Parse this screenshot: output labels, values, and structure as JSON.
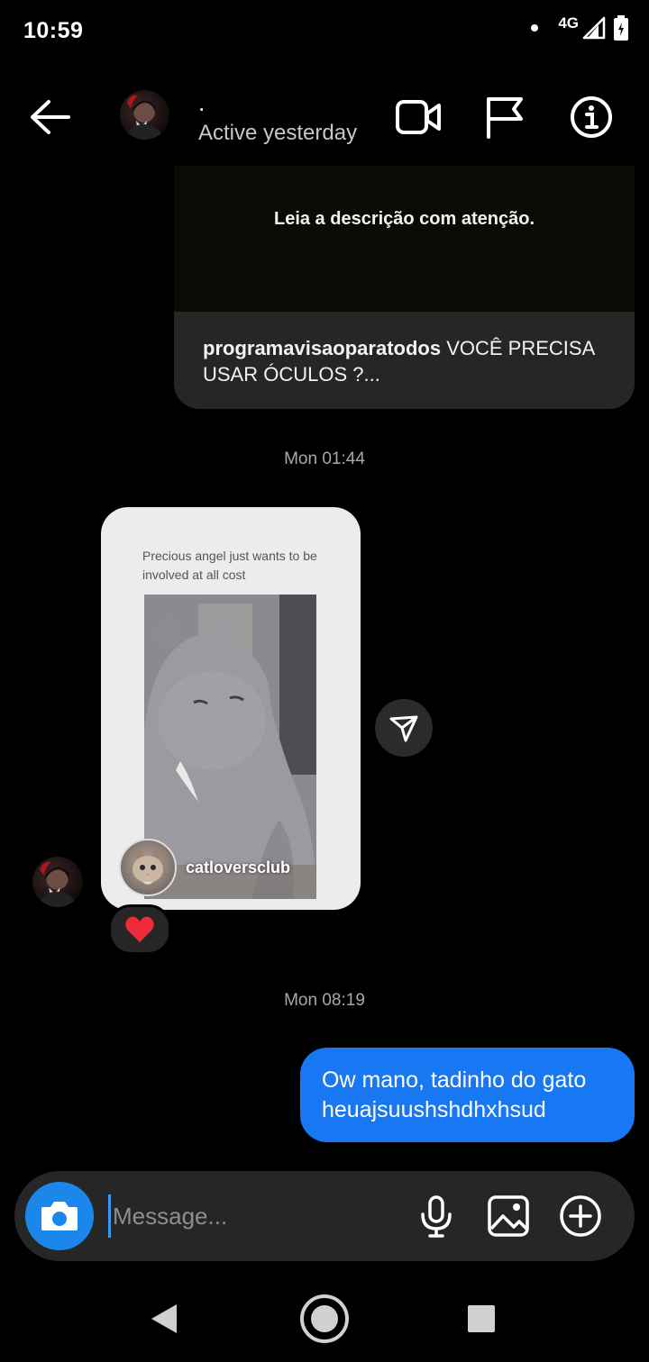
{
  "status_bar": {
    "time": "10:59",
    "network": "4G"
  },
  "header": {
    "name": ".",
    "status": "Active yesterday",
    "icons": [
      "back-arrow-icon",
      "video-call-icon",
      "flag-icon",
      "info-icon"
    ]
  },
  "shared_post": {
    "preview_text": "Leia a descrição com atenção.",
    "username": "programavisaoparatodos",
    "caption": "VOCÊ PRECISA USAR ÓCULOS ?..."
  },
  "timestamps": [
    "Mon 01:44",
    "Mon 08:19"
  ],
  "reel": {
    "caption": "Precious angel just wants to be involved at all cost",
    "username": "catloversclub"
  },
  "reaction": {
    "emoji": "heart"
  },
  "outgoing_message": "Ow mano, tadinho do gato heuajsuushshdhxhsud",
  "composer": {
    "placeholder": "Message...",
    "icons": [
      "camera-icon",
      "microphone-icon",
      "gallery-icon",
      "add-icon"
    ]
  },
  "nav_bar": {
    "icons": [
      "back-triangle-icon",
      "home-circle-icon",
      "recents-square-icon"
    ]
  },
  "colors": {
    "accent": "#1877f2",
    "camera": "#1b87ea",
    "bubble_dark": "#262626",
    "heart": "#ed2b39"
  }
}
